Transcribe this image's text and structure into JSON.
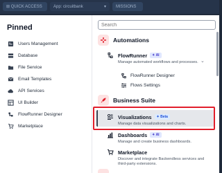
{
  "topbar": {
    "quick_access": "⊞ QUICK ACCESS",
    "app_select": "App: circuitbank",
    "missions": "MISSIONS"
  },
  "pinned": {
    "title": "Pinned",
    "items": [
      {
        "label": "Users Management",
        "icon": "users-icon"
      },
      {
        "label": "Database",
        "icon": "database-icon"
      },
      {
        "label": "File Service",
        "icon": "folder-icon"
      },
      {
        "label": "Email Templates",
        "icon": "envelope-icon"
      },
      {
        "label": "API Services",
        "icon": "cloud-icon"
      },
      {
        "label": "UI Builder",
        "icon": "layout-icon"
      },
      {
        "label": "FlowRunner Designer",
        "icon": "flow-icon"
      },
      {
        "label": "Marketplace",
        "icon": "cart-icon"
      }
    ]
  },
  "menu": {
    "search_placeholder": "Search",
    "automations": {
      "label": "Automations",
      "flowrunner": {
        "name": "FlowRunner",
        "badge": "✦ AI",
        "desc": "Manage automated workflows and processes."
      },
      "sub_items": [
        "FlowRunner Designer",
        "Flows Settings"
      ]
    },
    "business_suite": {
      "label": "Business Suite",
      "visualizations": {
        "name": "Visualizations",
        "badge": "✦ Beta",
        "desc": "Manage data visualizations and charts."
      },
      "dashboards": {
        "name": "Dashboards",
        "badge": "✦ AI",
        "desc": "Manage and create business dashboards."
      },
      "marketplace": {
        "name": "Marketplace",
        "desc": "Discover and integrate Backendless services and third-party extensions."
      }
    }
  },
  "colors": {
    "accent_red": "#e11d2a",
    "section_bg": "#fde2e2",
    "badge_ai": "#4338ca"
  }
}
